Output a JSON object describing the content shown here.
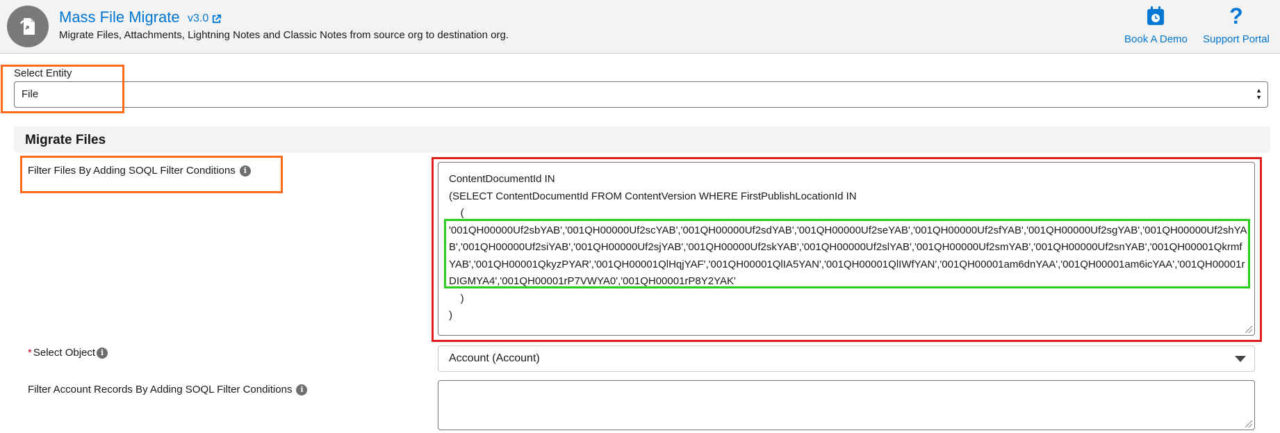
{
  "header": {
    "title": "Mass File Migrate",
    "version": "v3.0",
    "subtitle": "Migrate Files, Attachments, Lightning Notes and Classic Notes from source org to destination org.",
    "book_demo": "Book A Demo",
    "support_portal": "Support Portal"
  },
  "entity": {
    "label": "Select Entity",
    "value": "File"
  },
  "section": {
    "title": "Migrate Files"
  },
  "filter_files": {
    "label": "Filter Files By Adding SOQL Filter Conditions",
    "line1": "ContentDocumentId IN",
    "line2": "(SELECT ContentDocumentId FROM ContentVersion WHERE FirstPublishLocationId IN",
    "line3": "    (",
    "ids": "'001QH00000Uf2sbYAB','001QH00000Uf2scYAB','001QH00000Uf2sdYAB','001QH00000Uf2seYAB','001QH00000Uf2sfYAB','001QH00000Uf2sgYAB','001QH00000Uf2shYAB','001QH00000Uf2siYAB','001QH00000Uf2sjYAB','001QH00000Uf2skYAB','001QH00000Uf2slYAB','001QH00000Uf2smYAB','001QH00000Uf2snYAB','001QH00001QkrmfYAB','001QH00001QkyzPYAR','001QH00001QlHqjYAF','001QH00001QlIA5YAN','001QH00001QlIWfYAN','001QH00001am6dnYAA','001QH00001am6icYAA','001QH00001rDIGMYA4','001QH00001rP7VWYA0','001QH00001rP8Y2YAK'",
    "line5": "    )",
    "line6": ")"
  },
  "select_object": {
    "required_mark": "*",
    "label": "Select Object",
    "value": "Account (Account)"
  },
  "filter_records": {
    "label": "Filter Account Records By Adding SOQL Filter Conditions",
    "value": ""
  },
  "colors": {
    "brand": "#0176d3",
    "highlight_orange": "#ff6a1f",
    "highlight_red": "#e0201f",
    "highlight_green": "#2ecc1f"
  }
}
